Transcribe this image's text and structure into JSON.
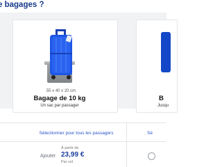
{
  "header": {
    "title": "de bagages ?"
  },
  "baggage_options": [
    {
      "dimensions": "55 x 40 x 20 cm",
      "title": "Bagage de 10 kg",
      "subtitle": "Un sac par passager",
      "select_label": "Sélectionner pour tous les passagers",
      "add_label": "Ajouter",
      "price_prefix": "À partir de",
      "price": "23,99 €",
      "price_unit": "Par vol"
    },
    {
      "title": "B",
      "subtitle": "Jusqu",
      "select_label": "Sé"
    }
  ],
  "colors": {
    "accent": "#1447c8",
    "link": "#2a55c9",
    "price": "#1c3f9e"
  },
  "icons": {
    "suitcase": "suitcase-icon",
    "scale": "scale-icon"
  }
}
